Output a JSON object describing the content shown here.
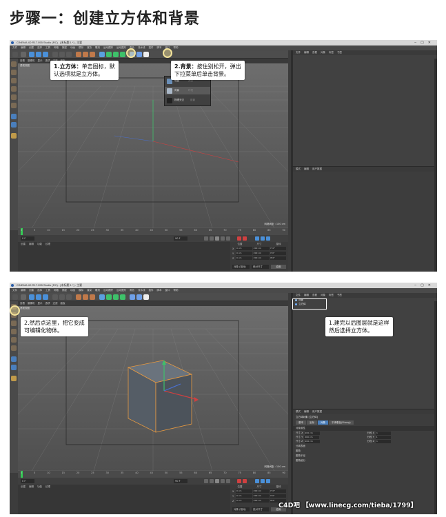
{
  "page_title": "步骤一：创建立方体和背景",
  "window_title": "CINEMA 4D R17.055 Studio (RC) - [未标题 1 *] - 主要",
  "menubar": [
    "文件",
    "编辑",
    "创建",
    "选择",
    "工具",
    "网格",
    "捕捉",
    "动画",
    "模拟",
    "渲染",
    "雕刻",
    "运动跟踪",
    "运动图形",
    "角色",
    "流水线",
    "插件",
    "脚本",
    "窗口",
    "帮助"
  ],
  "viewport": {
    "menu": [
      "查看",
      "摄像机",
      "显示",
      "选项",
      "过滤",
      "面板"
    ],
    "label": "透视视图",
    "scale": "网格间距 : 100 cm"
  },
  "timeline": {
    "ticks": [
      "0",
      "5",
      "10",
      "15",
      "20",
      "25",
      "30",
      "35",
      "40",
      "45",
      "50",
      "55",
      "60",
      "65",
      "70",
      "75",
      "80",
      "85",
      "90"
    ],
    "end": "0 F"
  },
  "playbar": {
    "start": "0 F",
    "current": "0 F",
    "end": "90 F"
  },
  "materials_menu": [
    "创建",
    "编辑",
    "功能",
    "纹理"
  ],
  "coords": {
    "headers": [
      "位置",
      "尺寸",
      "旋转"
    ],
    "rows": [
      {
        "axis": "X",
        "pos": "0 cm",
        "size": "200 cm",
        "rot": "H 0°"
      },
      {
        "axis": "Y",
        "pos": "0 cm",
        "size": "200 cm",
        "rot": "P 0°"
      },
      {
        "axis": "Z",
        "pos": "0 cm",
        "size": "200 cm",
        "rot": "B 0°"
      }
    ],
    "mode": "对象 (相对)",
    "size_mode": "绝对尺寸",
    "apply": "应用"
  },
  "obj_manager": {
    "menu": [
      "文件",
      "编辑",
      "查看",
      "对象",
      "标签",
      "书签"
    ],
    "objects": [
      {
        "name": "背景",
        "color": "#8fbbe8"
      },
      {
        "name": "立方体",
        "color": "#6fb0ff"
      }
    ]
  },
  "attr_manager": {
    "menu": [
      "模式",
      "编辑",
      "用户数据"
    ],
    "title": "立方体对象 [立方体]",
    "tabs": [
      "基本",
      "坐标",
      "对象",
      "平滑着色(Phong)"
    ],
    "active_tab": "对象",
    "section": "对象属性",
    "fields": [
      {
        "label": "尺寸.X",
        "value": "200 cm"
      },
      {
        "label": "分段 X",
        "value": "1"
      },
      {
        "label": "尺寸.Y",
        "value": "200 cm"
      },
      {
        "label": "分段 Y",
        "value": "1"
      },
      {
        "label": "尺寸.Z",
        "value": "200 cm"
      },
      {
        "label": "分段 Z",
        "value": "1"
      }
    ],
    "checks": [
      "分离表面",
      "圆角",
      "圆角半径",
      "圆角细分"
    ]
  },
  "dropdown": {
    "items": [
      {
        "label": "地板",
        "sub": "天空"
      },
      {
        "label": "背景",
        "sub": "环境"
      },
      {
        "label": "物理天空",
        "sub": "前景"
      }
    ]
  },
  "callouts": {
    "cube": {
      "label": "1.立方体：",
      "text1": "单击图标，默",
      "text2": "认选项就是立方体。"
    },
    "background": {
      "label": "2.背景：",
      "text1": "按住别松开，弹出",
      "text2": "下拉菜单后单击背景。"
    },
    "editable": {
      "line1": "2.然后点这里，把它变成",
      "line2": "可编辑化物体。"
    },
    "layers": {
      "line1": "1.建完以后图层就是这样",
      "line2": "然后选择立方体。"
    }
  },
  "watermark": "C4D吧 【www.linecg.com/tieba/1799】",
  "colors": {
    "highlight": "#f3e39a",
    "c4d_bg": "#3c3c3c",
    "active_tab": "#4a7fbd",
    "timeline_marker": "#35c955"
  }
}
